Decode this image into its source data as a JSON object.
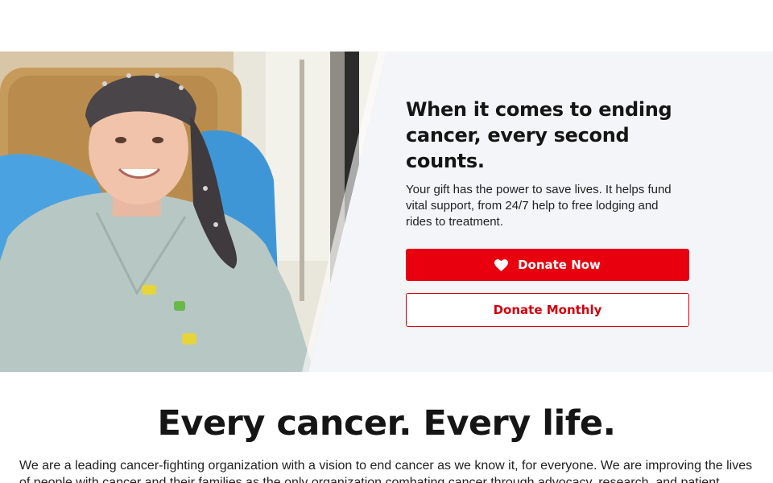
{
  "hero": {
    "title": "When it comes to ending cancer, every second counts.",
    "text": "Your gift has the power to save lives. It helps fund vital support, from 24/7 help to free lodging and rides to treatment.",
    "donate_now_label": "Donate Now",
    "donate_monthly_label": "Donate Monthly",
    "photo_alt": "Smiling patient wearing a headscarf and hospital gown",
    "icons": {
      "donate_now": "heart-icon"
    },
    "colors": {
      "primary": "#e8000f",
      "hero_bg": "#f4f5f9"
    }
  },
  "section": {
    "title": "Every cancer. Every life.",
    "text": "We are a leading cancer-fighting organization with a vision to end cancer as we know it, for everyone. We are improving the lives of people with cancer and their families as the only organization combating cancer through advocacy, research, and patient"
  }
}
